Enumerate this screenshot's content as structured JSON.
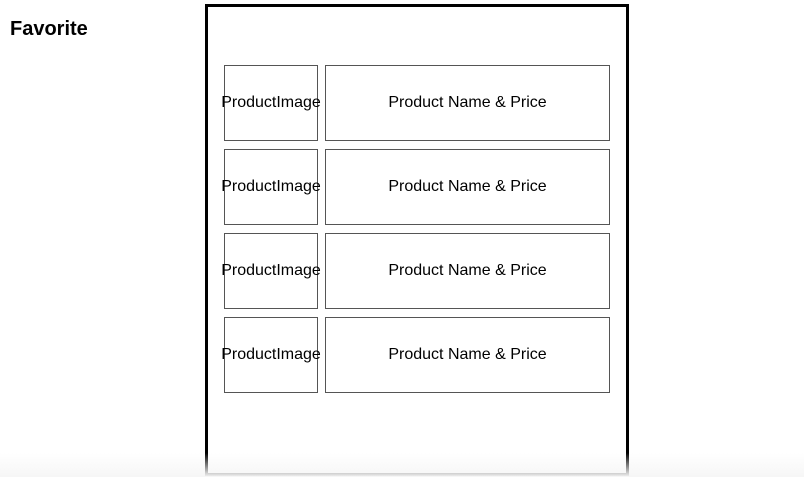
{
  "page": {
    "title": "Favorite"
  },
  "favorites": [
    {
      "image_line1": "Product",
      "image_line2": "Image",
      "info": "Product Name & Price"
    },
    {
      "image_line1": "Product",
      "image_line2": "Image",
      "info": "Product Name & Price"
    },
    {
      "image_line1": "Product",
      "image_line2": "Image",
      "info": "Product Name & Price"
    },
    {
      "image_line1": "Product",
      "image_line2": "Image",
      "info": "Product Name & Price"
    }
  ]
}
